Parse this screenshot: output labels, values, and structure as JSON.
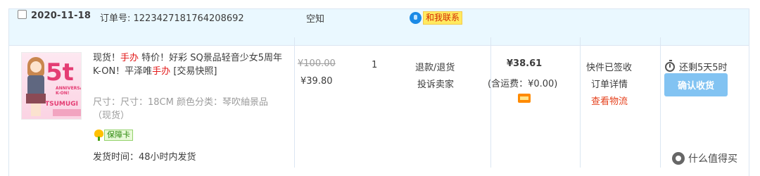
{
  "order": {
    "date": "2020-11-18",
    "order_no_text": "订单号: 1223427181764208692",
    "shop_name": "空知",
    "contact_label": "和我联系"
  },
  "item": {
    "title_parts": [
      "现货！",
      "手办",
      " 特价！好彩 SQ景品轻音少女5周年 K-ON！平泽唯",
      "手办",
      " [交易快照]"
    ],
    "spec_text": "尺寸：尺寸：18CM  颜色分类：琴吹紬景品（现货）",
    "guarantee_label": "保障卡",
    "shipping_text": "发货时间：48小时内发货",
    "thumb_number": "5t",
    "thumb_anniversary": "ANNIVERSARY K-ON!",
    "thumb_name": "TSUMUGI"
  },
  "price": {
    "original": "¥100.00",
    "current": "¥39.80"
  },
  "quantity": "1",
  "item_ops": {
    "refund": "退款/退货",
    "complain": "投诉卖家"
  },
  "payment": {
    "total": "¥38.61",
    "freight": "(含运费：¥0.00)"
  },
  "status": {
    "shipping_status": "快件已签收",
    "detail_link": "订单详情",
    "logistics_link": "查看物流"
  },
  "actions": {
    "remaining_time": "还剩5天5时",
    "confirm_button": "确认收货"
  },
  "watermark": {
    "text": "什么值得买"
  },
  "colors": {
    "header_bg": "#eaf8ff",
    "accent_red": "#e21a1a",
    "logistics_link": "#e5421e",
    "confirm_button_bg": "#82c3f2"
  }
}
